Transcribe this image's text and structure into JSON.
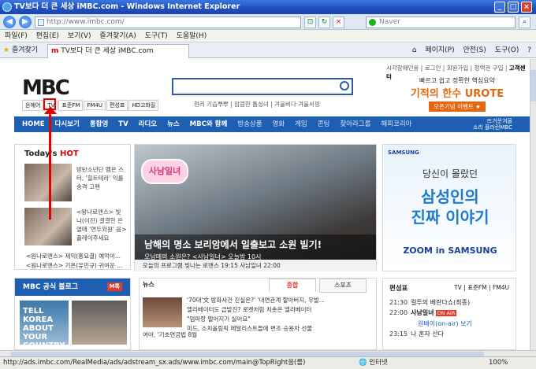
{
  "window": {
    "title": "TV보다 더 큰 세상 iMBC.com - Windows Internet Explorer"
  },
  "browser": {
    "url": "http://www.imbc.com/",
    "search_placeholder": "Naver",
    "menu": [
      "파일(F)",
      "편집(E)",
      "보기(V)",
      "즐겨찾기(A)",
      "도구(T)",
      "도움말(H)"
    ],
    "favorites": "즐겨찾기",
    "tab_title": "TV보다 더 큰 세상 iMBC.com",
    "tools": [
      "페이지(P)",
      "안전(S)",
      "도구(O)"
    ]
  },
  "site": {
    "top_links": "시각장애인용 | 로그인 | 회원가입 | 정액권 구입 |",
    "top_links_bold": "고객센터",
    "logo": "MBC",
    "search_sublinks": "현리 기습뿌뿌 | 암큼한 톱싱녀 | 겨울비다 겨울서핑",
    "channels": [
      "온에어",
      "TV",
      "표준FM",
      "FM4U",
      "편성표",
      "HD고화질"
    ],
    "ad_top": {
      "line1": "빠르고 쉽고 정확한 핵심요약",
      "line2": "기적의 한수 UROTE",
      "button": "오픈기념 이벤트 ★"
    },
    "nav": [
      "HOME",
      "다시보기",
      "통합영",
      "TV",
      "라디오",
      "뉴스",
      "MBC와 함께"
    ],
    "nav_sub": [
      "방송상품",
      "영화",
      "게임",
      "콘팅",
      "찾아라그룹",
      "해피코리아"
    ],
    "nav_right": {
      "line1": "뜨거운겨울",
      "line2": "소리 플러런MBC"
    }
  },
  "todays_hot": {
    "title": "Today's",
    "title_hot": "HOT",
    "item1": "방탄소년단 멤은 스터, '힐트테라' 익를 송격 고팬",
    "item2": "<왕나로맨스> 빛 나(이진) 결결한 은 열매 '연두와원' 음> 플레이주세요",
    "bullets": [
      "<원나로맨스> 제익(홍요결) 예억이...",
      "<원나로맨스> 기은(유민규) 귀여운 ..."
    ]
  },
  "hero": {
    "badge": "사남일녀",
    "caption": "남해의 명소 보리암에서 일출보고 소원 빌기!",
    "sub": "오남매의 소원은? <사남일녀> 오늘밤 10시",
    "bar": "오늘의 프로그램     빛나는 로맨스  19:15     사남일녀  22:00"
  },
  "samsung_ad": {
    "brand": "SAMSUNG",
    "line1": "당신이 몰랐던",
    "line2": "삼성인의",
    "line3": "진짜 이야기",
    "line4": "ZOOM in SAMSUNG"
  },
  "blog": {
    "title": "MBC 공식 블로그",
    "tag": "M톡",
    "img_text": "TELL KOREA ABOUT YOUR COUNTRY"
  },
  "news": {
    "tabs": [
      "뉴스",
      "종합",
      "스포츠"
    ],
    "items": [
      "'70대'文 방화사건 진실은?' '내연관계 할아버지, 우발...",
      "엘리베이터도 급발진? 로켓처럼 치솟은 엘리베이터",
      "\"엄마랑 떨어지기 싫어요\"",
      "미드, 소치올림픽 메달리스트들에 변조 승용차 선물"
    ],
    "caption": "여야, '기초연금법 8월"
  },
  "schedule": {
    "title": "편성표",
    "tabs": "TV | 표준FM | FM4U",
    "rows": [
      {
        "time": "21:30",
        "show": "컬투의 베란다쇼(최종)",
        "live": ""
      },
      {
        "time": "22:00",
        "show": "사남일녀",
        "live": "ON AIR"
      },
      {
        "time": "",
        "show": "원배이(on-air) 보기",
        "live": ""
      },
      {
        "time": "23:15",
        "show": "나 혼자 산다",
        "live": ""
      }
    ]
  },
  "status": {
    "text": "http://ads.imbc.com/RealMedia/ads/adstream_sx.ads/www.imbc.com/main@TopRight을(를)",
    "zone": "인터넷",
    "zoom": "100%"
  }
}
